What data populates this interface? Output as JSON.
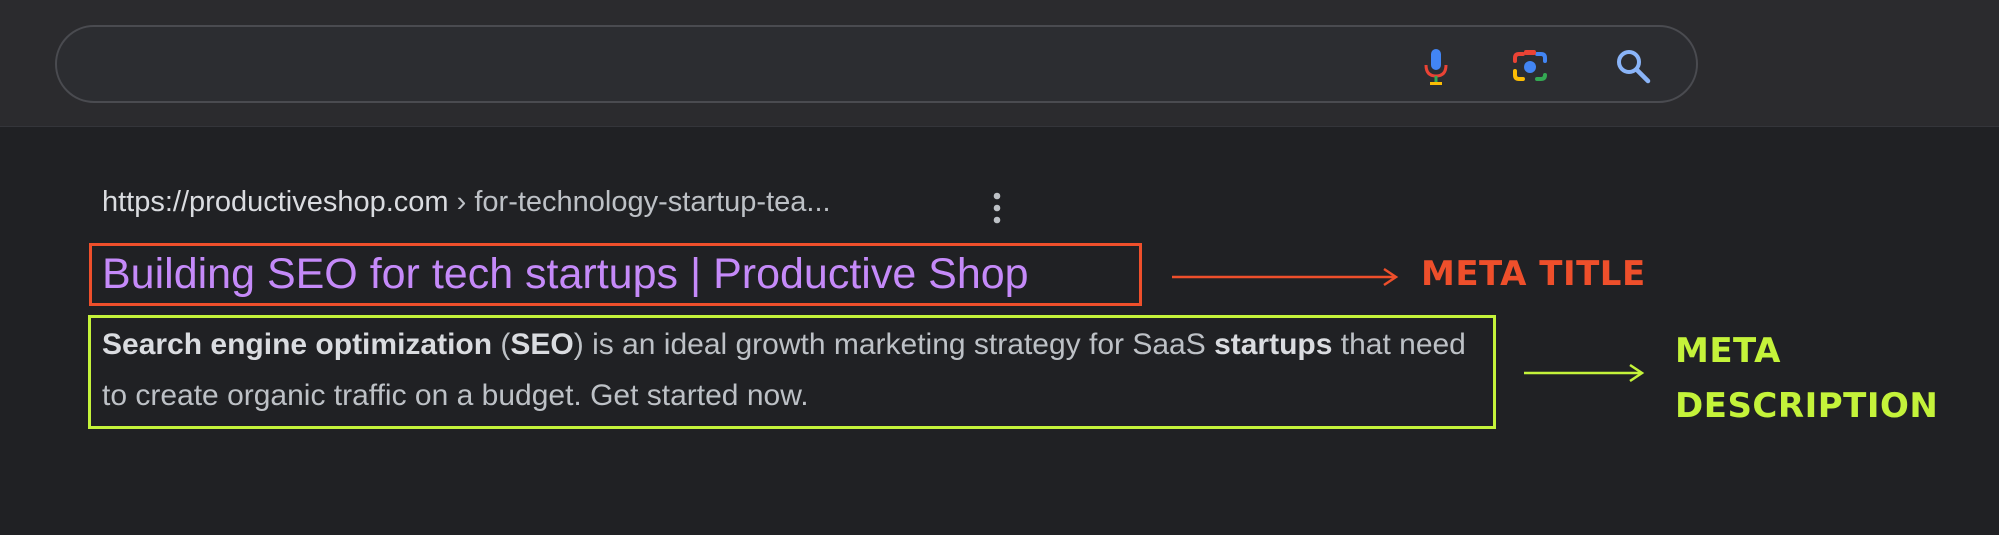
{
  "search": {
    "query": "",
    "placeholder": ""
  },
  "icons": {
    "mic": "mic-icon",
    "camera": "camera-lens-icon",
    "search": "search-icon",
    "more": "more-vert-icon"
  },
  "result": {
    "url_domain": "https://productiveshop.com",
    "url_path": " › for-technology-startup-tea...",
    "title": "Building SEO for tech startups | Productive Shop",
    "description": {
      "part1": "Search engine optimization",
      "part2": " (",
      "part3": "SEO",
      "part4": ") is an ideal growth marketing strategy for SaaS ",
      "part5": "startups",
      "part6": " that need to create organic traffic on a budget. Get started now."
    }
  },
  "annotations": {
    "meta_title": "META TITLE",
    "meta_description_line1": "META",
    "meta_description_line2": "DESCRIPTION"
  },
  "colors": {
    "background": "#202124",
    "title_link": "#c58af9",
    "meta_title_accent": "#ee4f2b",
    "meta_description_accent": "#c4f33a"
  }
}
